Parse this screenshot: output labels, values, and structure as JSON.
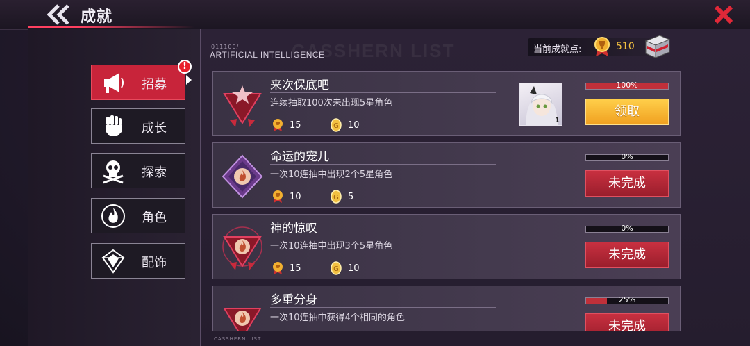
{
  "header": {
    "title": "成就"
  },
  "nav": {
    "items": [
      {
        "label": "招募",
        "icon": "megaphone-icon",
        "active": true
      },
      {
        "label": "成长",
        "icon": "fist-icon",
        "active": false
      },
      {
        "label": "探索",
        "icon": "skull-icon",
        "active": false
      },
      {
        "label": "角色",
        "icon": "flame-icon",
        "active": false
      },
      {
        "label": "配饰",
        "icon": "gem-icon",
        "active": false
      }
    ],
    "badge": "!"
  },
  "section": {
    "subtitle": "011100/",
    "title": "ARTIFICIAL INTELLIGENCE",
    "ghost": "CASSHERN LIST"
  },
  "points": {
    "label": "当前成就点:",
    "value": "510"
  },
  "achievements": [
    {
      "title": "来次保底吧",
      "desc": "连续抽取100次未出现5星角色",
      "reward_points": "15",
      "reward_coins": "10",
      "progress_text": "100%",
      "progress": 1.0,
      "button": "领取",
      "status": "claim",
      "portrait_count": "1"
    },
    {
      "title": "命运的宠儿",
      "desc": "一次10连抽中出现2个5星角色",
      "reward_points": "10",
      "reward_coins": "5",
      "progress_text": "0%",
      "progress": 0,
      "button": "未完成",
      "status": "pending"
    },
    {
      "title": "神的惊叹",
      "desc": "一次10连抽中出现3个5星角色",
      "reward_points": "15",
      "reward_coins": "10",
      "progress_text": "0%",
      "progress": 0,
      "button": "未完成",
      "status": "pending"
    },
    {
      "title": "多重分身",
      "desc": "一次10连抽中获得4个相同的角色",
      "reward_points": "",
      "reward_coins": "",
      "progress_text": "25%",
      "progress": 0.25,
      "button": "未完成",
      "status": "pending"
    }
  ],
  "footer": {
    "tag": "CASSHERN LIST"
  },
  "colors": {
    "accent_red": "#c8243a",
    "claim_gold": "#f0a020",
    "points_gold": "#f2c040"
  }
}
